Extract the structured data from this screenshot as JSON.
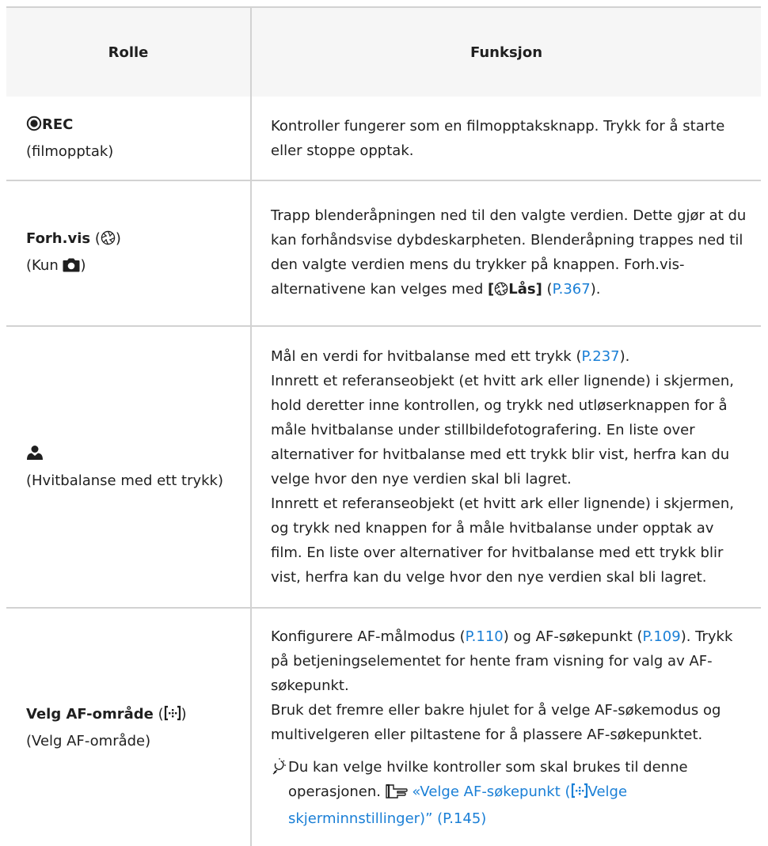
{
  "header": {
    "role": "Rolle",
    "function": "Funksjon"
  },
  "rows": [
    {
      "role_title": "REC",
      "role_sub": "(filmopptak)",
      "func_text": "Kontroller fungerer som en filmopptaksknapp. Trykk for å starte eller stoppe opptak."
    },
    {
      "role_title": "Forh.vis",
      "role_open": "(",
      "role_close": ")",
      "role_sub_prefix": "(Kun ",
      "role_sub_suffix": ")",
      "func_text": "Trapp blenderåpningen ned til den valgte verdien. Dette gjør at du kan forhåndsvise dybdeskarpheten. Blenderåpning trappes ned til den valgte verdien mens du trykker på knappen. Forh.vis-alternativene kan velges med ",
      "func_bracket_open": "[",
      "func_bold": "Lås]",
      "func_link_open": " (",
      "func_link": "P.367",
      "func_link_close": ")."
    },
    {
      "role_sub": "(Hvitbalanse med ett trykk)",
      "func_line1": "Mål en verdi for hvitbalanse med ett trykk (",
      "func_line1_link": "P.237",
      "func_line1_close": ").",
      "func_para1": "Innrett et referanseobjekt (et hvitt ark eller lignende) i skjermen, hold deretter inne kontrollen, og trykk ned utløserknappen for å måle hvitbalanse under stillbildefotografering. En liste over alternativer for hvitbalanse med ett trykk blir vist, herfra kan du velge hvor den nye verdien skal bli lagret.",
      "func_para2": "Innrett et referanseobjekt (et hvitt ark eller lignende) i skjermen, og trykk ned knappen for å måle hvitbalanse under opptak av film. En liste over alternativer for hvitbalanse med ett trykk blir vist, herfra kan du velge hvor den nye verdien skal bli lagret."
    },
    {
      "role_title": "Velg AF-område",
      "role_open": " (",
      "role_close": ")",
      "role_sub": "(Velg AF-område)",
      "func_a": "Konfigurere AF-målmodus (",
      "func_a_link": "P.110",
      "func_b": ") og AF-søkepunkt (",
      "func_b_link": "P.109",
      "func_c": "). Trykk på betjeningselementet for hente fram visning for valg av AF-søkepunkt.",
      "func_para2": "Bruk det fremre eller bakre hjulet for å velge AF-søkemodus og multivelgeren eller piltastene for å plassere AF-søkepunktet.",
      "tip_text": "Du kan velge hvilke kontroller som skal brukes til denne operasjonen. ",
      "tip_link_a": "«Velge AF-søkepunkt (",
      "tip_link_b": "Velge skjerminnstillinger)” (P.145)"
    }
  ]
}
